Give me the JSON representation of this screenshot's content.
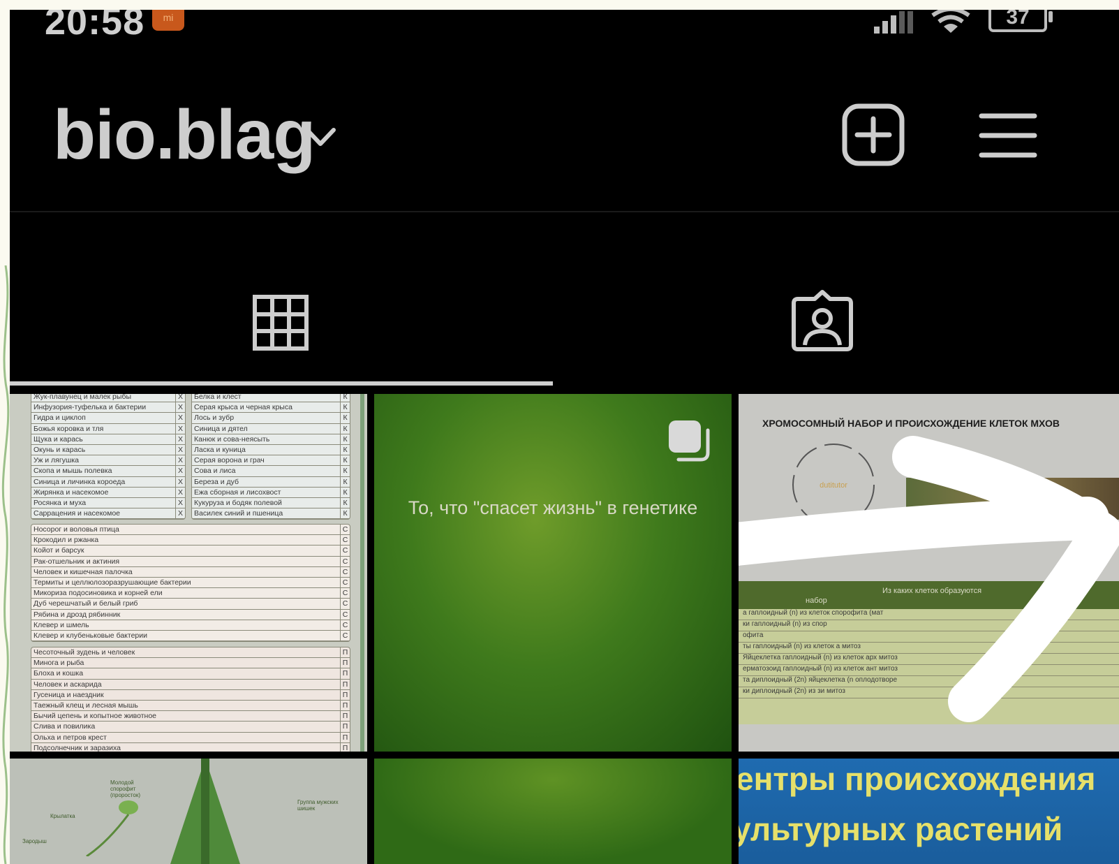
{
  "status_bar": {
    "time": "20:58",
    "app_badge": "mi",
    "battery": "37"
  },
  "header": {
    "username": "bio.blag",
    "icons": [
      "chevron-down-icon",
      "add-square-icon",
      "hamburger-menu-icon"
    ]
  },
  "tabs": [
    {
      "name": "grid",
      "icon": "grid-icon",
      "selected": true
    },
    {
      "name": "tagged",
      "icon": "tagged-person-icon",
      "selected": false
    }
  ],
  "posts": {
    "p1": {
      "table_a": [
        [
          "Жук-плавунец и малек рыбы",
          "Х"
        ],
        [
          "Инфузория-туфелька и бактерии",
          "Х"
        ],
        [
          "Гидра и циклоп",
          "Х"
        ],
        [
          "Божья коровка и тля",
          "Х"
        ],
        [
          "Щука и карась",
          "Х"
        ],
        [
          "Окунь и карась",
          "Х"
        ],
        [
          "Уж и лягушка",
          "Х"
        ],
        [
          "Скопа и мышь полевка",
          "Х"
        ],
        [
          "Синица и личинка короеда",
          "Х"
        ],
        [
          "Жирянка и насекомое",
          "Х"
        ],
        [
          "Росянка и муха",
          "Х"
        ],
        [
          "Саррацения и насекомое",
          "Х"
        ]
      ],
      "table_b": [
        [
          "Белка и клест",
          "К"
        ],
        [
          "Серая крыса и черная крыса",
          "К"
        ],
        [
          "Лось и зубр",
          "К"
        ],
        [
          "Синица и дятел",
          "К"
        ],
        [
          "Канюк и сова-неясыть",
          "К"
        ],
        [
          "Ласка и куница",
          "К"
        ],
        [
          "Серая ворона и грач",
          "К"
        ],
        [
          "Сова и лиса",
          "К"
        ],
        [
          "Береза и дуб",
          "К"
        ],
        [
          "Ежа сборная и лисохвост",
          "К"
        ],
        [
          "Кукуруза и бодяк полевой",
          "К"
        ],
        [
          "Василек синий и пшеница",
          "К"
        ]
      ],
      "table_c": [
        [
          "Носорог и воловья птица",
          "С"
        ],
        [
          "Крокодил и ржанка",
          "С"
        ],
        [
          "Койот и барсук",
          "С"
        ],
        [
          "Рак-отшельник и актиния",
          "С"
        ],
        [
          "Человек и кишечная палочка",
          "С"
        ],
        [
          "Термиты и целлюлозоразрушающие бактерии",
          "С"
        ],
        [
          "Микориза подосиновика и корней ели",
          "С"
        ],
        [
          "Дуб черешчатый и белый гриб",
          "С"
        ],
        [
          "Рябина и дрозд рябинник",
          "С"
        ],
        [
          "Клевер и шмель",
          "С"
        ],
        [
          "Клевер и клубеньковые бактерии",
          "С"
        ]
      ],
      "table_d": [
        [
          "Чесоточный зудень и человек",
          "П"
        ],
        [
          "Минога и рыба",
          "П"
        ],
        [
          "Блоха и кошка",
          "П"
        ],
        [
          "Человек и аскарида",
          "П"
        ],
        [
          "Гусеница и наездник",
          "П"
        ],
        [
          "Таежный клещ и лесная мышь",
          "П"
        ],
        [
          "Бычий цепень и копытное животное",
          "П"
        ],
        [
          "Слива и повилика",
          "П"
        ],
        [
          "Ольха и петров крест",
          "П"
        ],
        [
          "Подсолнечник и заразиха",
          "П"
        ]
      ]
    },
    "p2": {
      "caption": "То, что \"спасет жизнь\" в генетике",
      "icon": "multiple-photos-icon"
    },
    "p3": {
      "heading": "ХРОМОСОМНЫЙ НАБОР И ПРОИСХОЖДЕНИЕ КЛЕТОК МХОВ",
      "watermark": "dutitutor",
      "col_set": "набор",
      "col_origin": "Из каких клеток образуются",
      "rows": [
        "а        гаплоидный (n)      из клеток спорофита (мат",
        "ки        гаплоидный (n)        из спор",
        "офита",
        "ты       гаплоидный (n)       из клеток а              митоз",
        "Яйцеклетка  гаплоидный (n)   из клеток арх            митоз",
        "ерматозоид  гаплоидный (n)   из клеток ант            митоз",
        "та       диплоидный (2n)     яйцеклетка (n            оплодотворе",
        "ки       диплоидный (2n)        из зи                 митоз"
      ]
    },
    "p4": {
      "label_1": "Молодой спорофит (проросток)",
      "label_2": "Крылатка",
      "label_3": "Зародыш",
      "label_4": "Группа мужских шишек"
    },
    "p6": {
      "line1": "ентры происхождения",
      "line2": "ультурных растений"
    }
  },
  "colors": {
    "background": "#000000",
    "text": "#cdcdcd",
    "badge": "#c8581c"
  }
}
